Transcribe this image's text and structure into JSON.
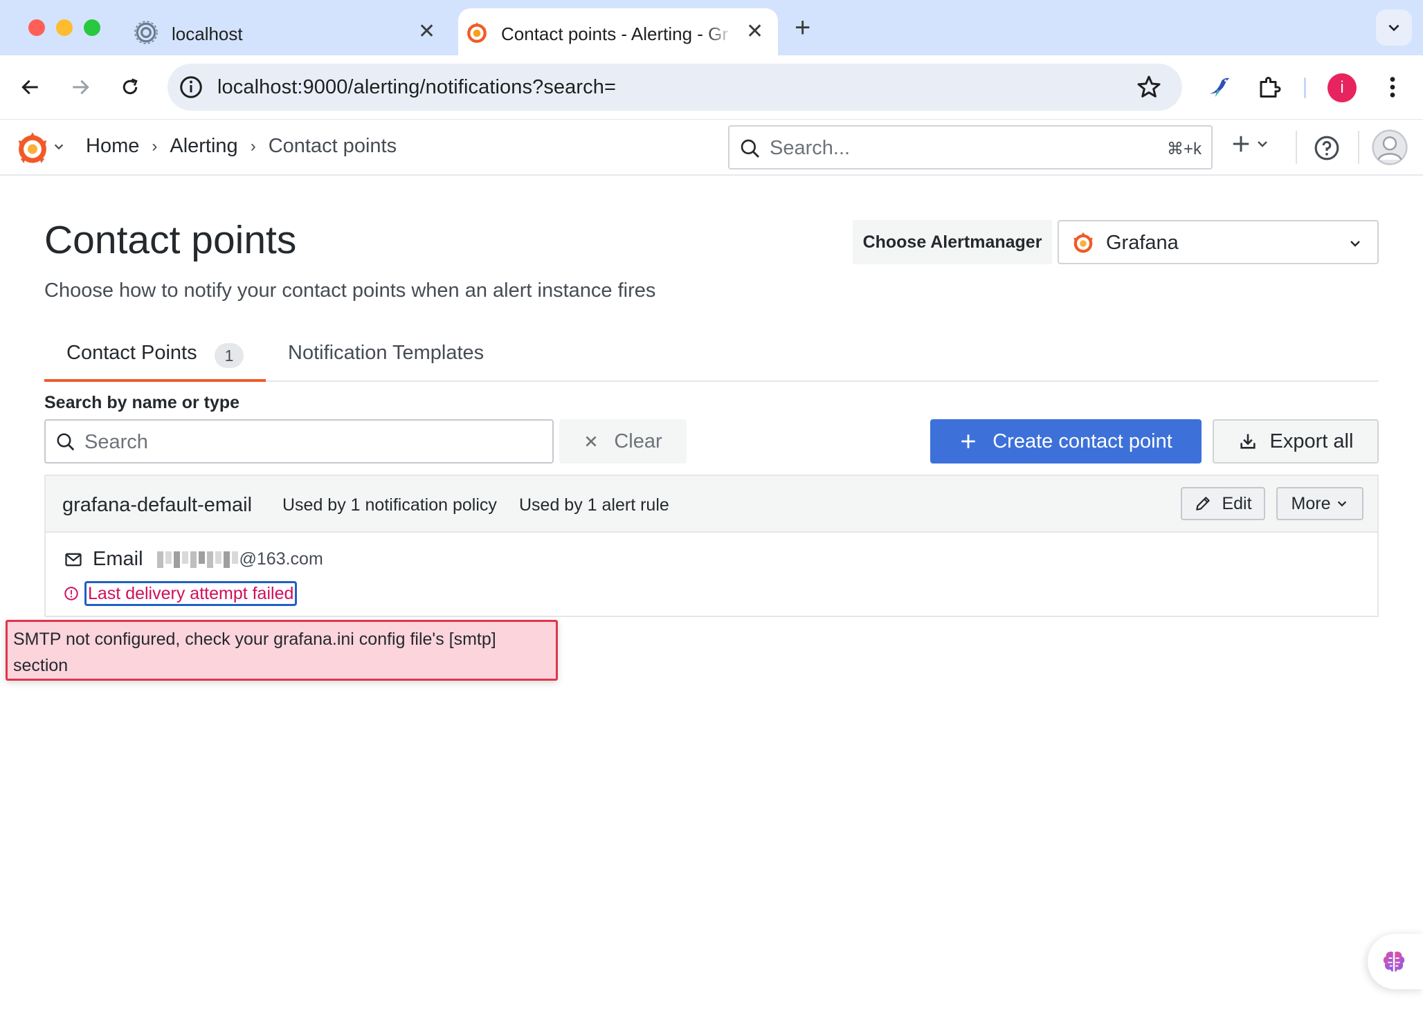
{
  "browser": {
    "tabs": [
      {
        "title": "localhost",
        "active": false
      },
      {
        "title": "Contact points - Alerting - Gr",
        "active": true
      }
    ],
    "url": "localhost:9000/alerting/notifications?search=",
    "profile_initial": "i"
  },
  "topbar": {
    "breadcrumb": [
      "Home",
      "Alerting",
      "Contact points"
    ],
    "search_placeholder": "Search...",
    "search_shortcut": "⌘+k"
  },
  "page": {
    "title": "Contact points",
    "subtitle": "Choose how to notify your contact points when an alert instance fires",
    "alertmanager_label": "Choose Alertmanager",
    "alertmanager_value": "Grafana"
  },
  "tabs": [
    {
      "label": "Contact Points",
      "count": "1",
      "active": true
    },
    {
      "label": "Notification Templates",
      "active": false
    }
  ],
  "search": {
    "label": "Search by name or type",
    "placeholder": "Search",
    "clear_label": "Clear"
  },
  "actions": {
    "create_label": "Create contact point",
    "export_label": "Export all"
  },
  "contact_point": {
    "name": "grafana-default-email",
    "policy_usage": "Used by 1 notification policy",
    "rule_usage": "Used by 1 alert rule",
    "edit_label": "Edit",
    "more_label": "More",
    "integration_type": "Email",
    "email_domain": "@163.com",
    "error_link": "Last delivery attempt failed"
  },
  "tooltip": {
    "text": "SMTP not configured, check your grafana.ini config file's [smtp] section"
  },
  "colors": {
    "accent": "#f05a28",
    "primary": "#3d71d9",
    "error": "#d10e5c",
    "tooltip_bg": "#fcd4dc"
  }
}
